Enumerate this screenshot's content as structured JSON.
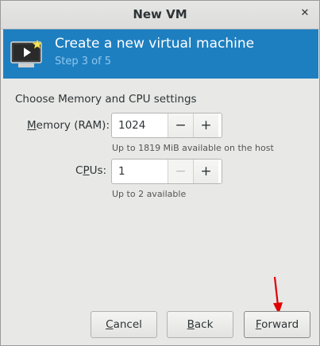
{
  "window": {
    "title": "New VM",
    "close_glyph": "✕"
  },
  "banner": {
    "heading": "Create a new virtual machine",
    "step": "Step 3 of 5",
    "icon": "vm-monitor-icon",
    "color": "#1e7fc0"
  },
  "section": {
    "title": "Choose Memory and CPU settings"
  },
  "memory": {
    "label_mnemonic": "M",
    "label_rest": "emory (RAM):",
    "value": "1024",
    "decrement": "−",
    "increment": "+",
    "hint": "Up to 1819 MiB available on the host"
  },
  "cpus": {
    "label_pre": "C",
    "label_mnemonic": "P",
    "label_rest": "Us:",
    "value": "1",
    "decrement": "−",
    "increment": "+",
    "hint": "Up to 2 available"
  },
  "buttons": {
    "cancel_mnemonic": "C",
    "cancel_rest": "ancel",
    "back_mnemonic": "B",
    "back_rest": "ack",
    "forward_mnemonic": "F",
    "forward_rest": "orward"
  },
  "annotation": {
    "arrow_color": "#e00000"
  }
}
